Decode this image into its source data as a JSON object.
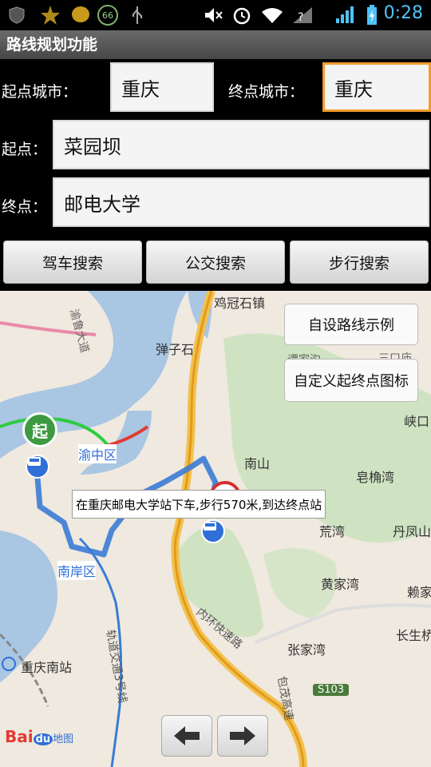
{
  "status_bar": {
    "time": "0:28",
    "icons": [
      "shield-icon",
      "star-icon",
      "chat-icon",
      "badge-66-icon",
      "usb-icon",
      "mute-icon",
      "alarm-icon",
      "wifi-icon",
      "signal-1-icon",
      "signal-2-icon",
      "battery-charging-icon"
    ],
    "badge_number": "66"
  },
  "app": {
    "title": "路线规划功能"
  },
  "form": {
    "start_city_label": "起点城市：",
    "start_city_value": "重庆",
    "end_city_label": "终点城市：",
    "end_city_value": "重庆",
    "start_label": "起点：",
    "start_value": "菜园坝",
    "end_label": "终点：",
    "end_value": "邮电大学"
  },
  "buttons": {
    "drive": "驾车搜索",
    "transit": "公交搜索",
    "walk": "步行搜索"
  },
  "map": {
    "overlay_buttons": {
      "custom_route": "自设路线示例",
      "custom_icons": "自定义起终点图标"
    },
    "start_marker": "起",
    "tooltip": "在重庆邮电大学站下车,步行570米,到达终点站",
    "labels": {
      "jiguanshi": "鸡冠石镇",
      "danzishi": "弹子石",
      "yuzhong": "渝中区",
      "nanshan": "南山",
      "xiakou": "峡口",
      "gaomeiwan": "皂桷湾",
      "huangwan": "荒湾",
      "danfengshan": "丹凤山",
      "huangjiawan": "黄家湾",
      "laijia": "赖家",
      "nanan": "南岸区",
      "zhangjiawan": "张家湾",
      "changsheng": "长生桥",
      "chongqing_south": "重庆南站",
      "rail_line3": "轨道交通3号线",
      "ring_expressway": "内环快速路",
      "baomao_expressway": "包茂高速",
      "yulu_avenue": "渝鲁大道",
      "s103": "S103",
      "sanguanmiao": "三口庙",
      "tanxi": "谭家沟"
    },
    "nav_prev": "previous-arrow",
    "nav_next": "next-arrow",
    "logo_bai": "Bai",
    "logo_du": "du",
    "logo_ditu": "地图"
  }
}
